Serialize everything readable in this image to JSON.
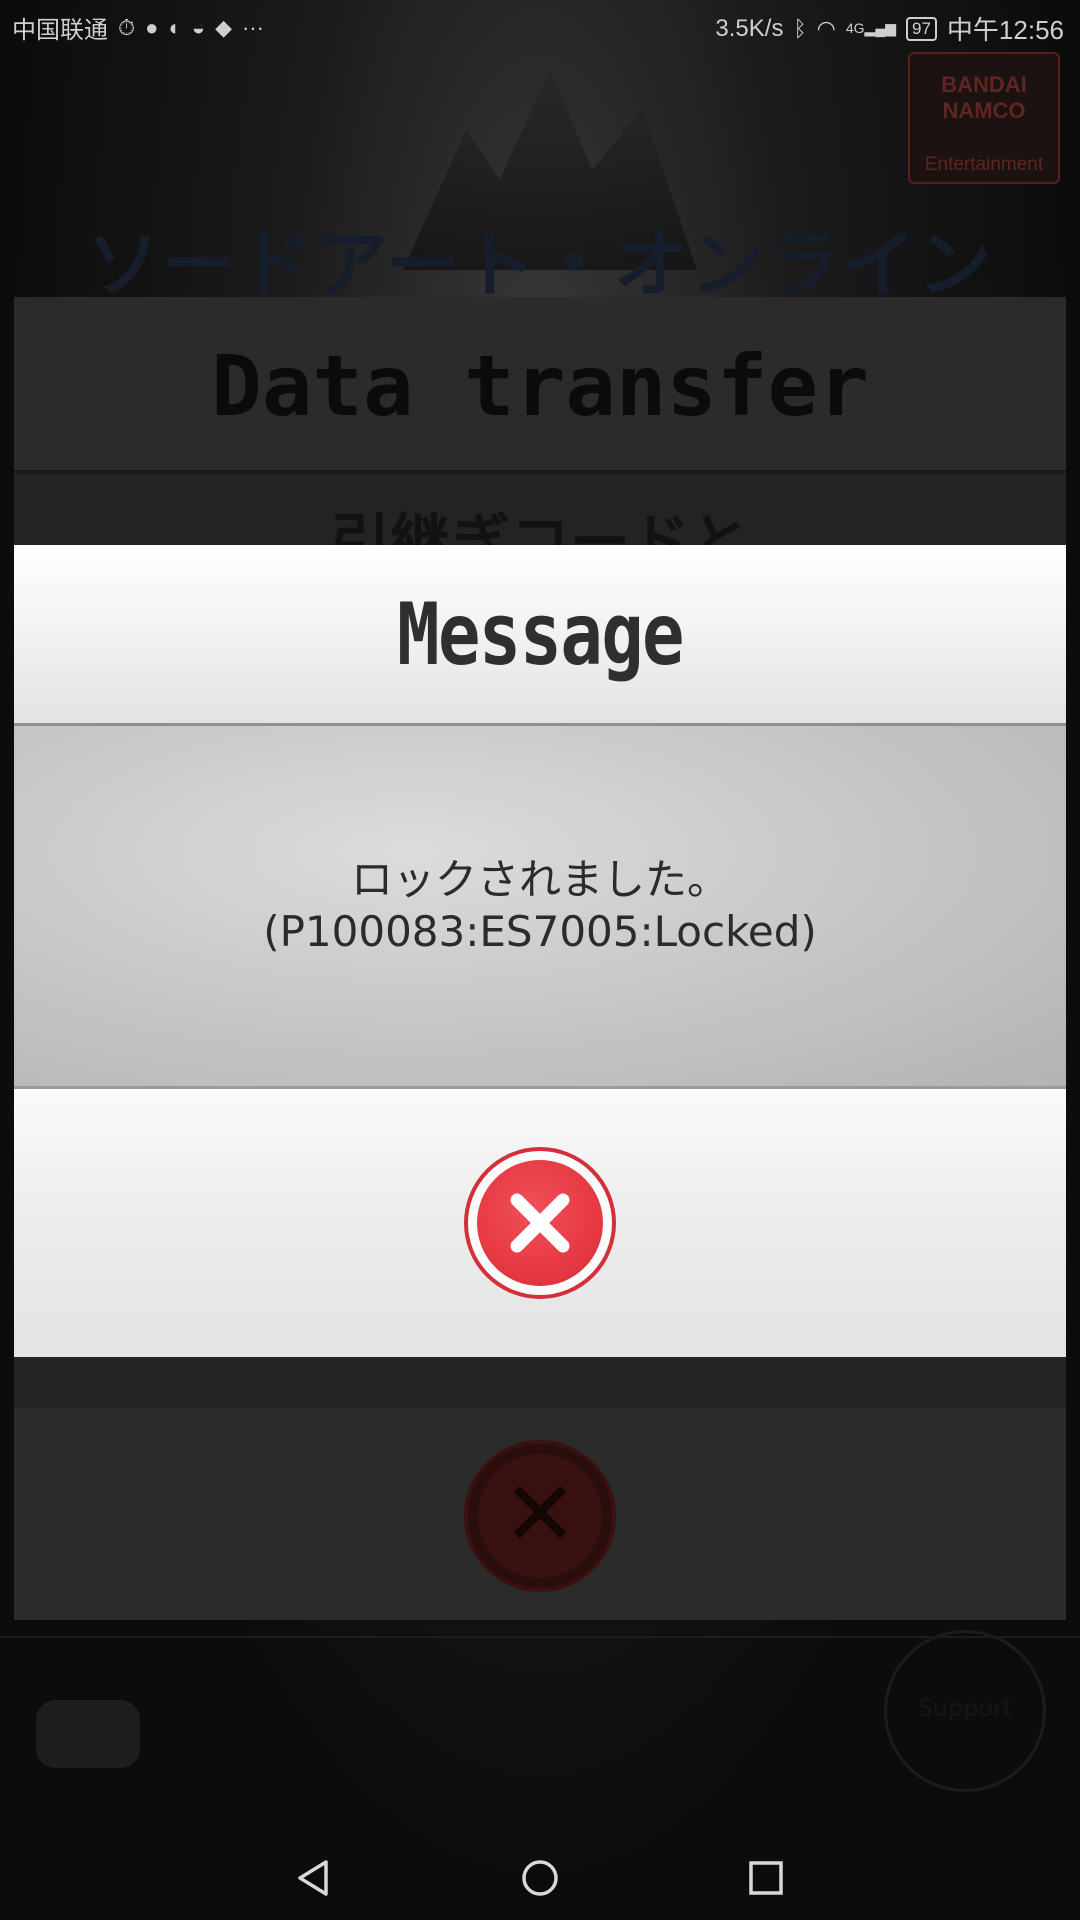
{
  "status_bar": {
    "carrier": "中国联通",
    "net_speed": "3.5K/s",
    "signal_type": "4G",
    "battery": "97",
    "time": "中午12:56"
  },
  "background": {
    "publisher_logo": {
      "line1": "BANDAI",
      "line2": "NAMCO",
      "line3": "Entertainment"
    },
    "game_title": "ソードアート・オンライン",
    "panel_title": "Data transfer",
    "panel_instruction": "引継ぎコードと",
    "support_label": "Support"
  },
  "dialog": {
    "title": "Message",
    "message_line1": "ロックされました。",
    "message_line2": "(P100083:ES7005:Locked)",
    "close_icon": "close-x-icon"
  },
  "nav_bar": {
    "back_icon": "back-triangle-icon",
    "home_icon": "home-circle-icon",
    "recents_icon": "recents-square-icon"
  },
  "colors": {
    "close_red": "#e63943",
    "dialog_header": "#f2f2f2",
    "dialog_body": "#c4c4c4"
  }
}
